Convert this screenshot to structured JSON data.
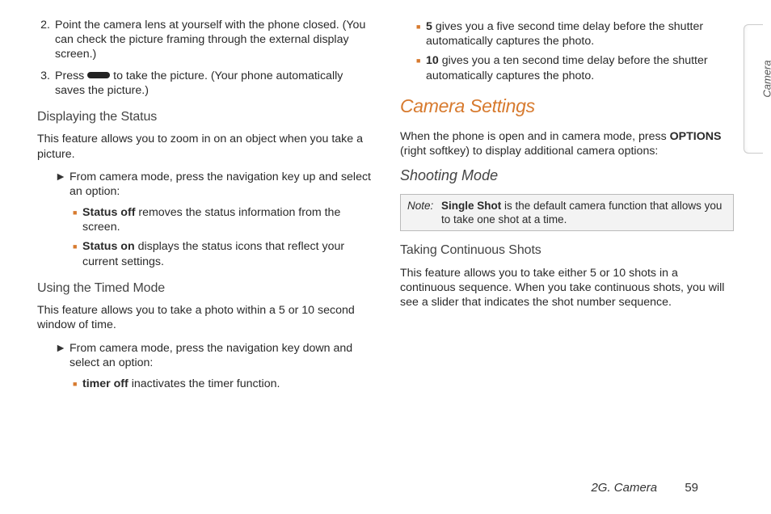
{
  "side_tab": "Camera",
  "footer": {
    "section": "2G. Camera",
    "page": "59"
  },
  "left": {
    "step2_num": "2.",
    "step2": "Point the camera lens at yourself with the phone closed. (You can check the picture framing through the external display screen.)",
    "step3_num": "3.",
    "step3_a": "Press ",
    "step3_b": " to take the picture. (Your phone automatically saves the picture.)",
    "h_display": "Displaying the Status",
    "display_p": "This feature allows you to zoom in on an object when you take a picture.",
    "display_arrow": "From camera mode, press the navigation key up and select an option:",
    "status_off_b": "Status off",
    "status_off_t": " removes the status information from the screen.",
    "status_on_b": "Status on",
    "status_on_t": " displays the status icons that reflect your current settings.",
    "h_timed": "Using the Timed Mode",
    "timed_p": "This feature allows you to take a photo within a 5 or 10 second window of time.",
    "timed_arrow": "From camera mode, press the navigation key down and select an option:",
    "timer_off_b": "timer off",
    "timer_off_t": " inactivates the timer function."
  },
  "right": {
    "five_b": "5",
    "five_t": " gives you a five second time delay before the shutter automatically captures the photo.",
    "ten_b": "10",
    "ten_t": " gives you a ten second time delay before the shutter automatically captures the photo.",
    "h_settings": "Camera Settings",
    "settings_p_a": "When the phone is open and in camera mode, press ",
    "settings_p_b": "OPTIONS",
    "settings_p_c": " (right softkey) to display additional camera options:",
    "h_shooting": "Shooting Mode",
    "note_label": "Note:",
    "note_bold": "Single Shot",
    "note_rest": " is the default camera function that allows you to take one shot at a time.",
    "h_cont": "Taking Continuous Shots",
    "cont_p": "This feature allows you to take either 5 or 10 shots in a continuous sequence. When you take continuous shots, you will see a slider that indicates the shot number sequence."
  }
}
